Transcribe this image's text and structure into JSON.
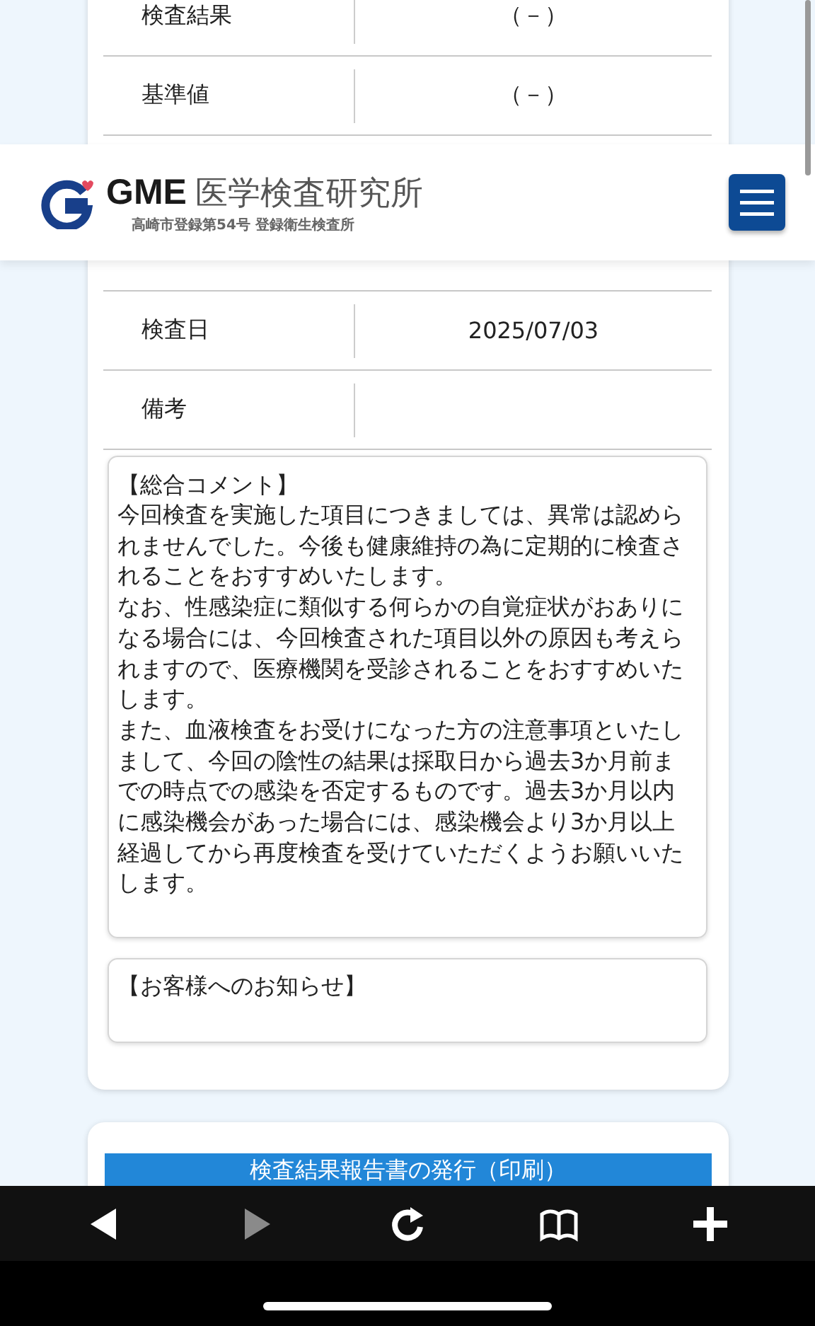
{
  "header": {
    "brand": "GME",
    "name": "医学検査研究所",
    "subtitle": "高崎市登録第54号 登録衛生検査所"
  },
  "results": [
    {
      "label": "検査結果",
      "value": "（－）"
    },
    {
      "label": "基準値",
      "value": "（－）"
    },
    {
      "label": "検査日",
      "value": "2025/07/03",
      "hidden_before": true
    },
    {
      "label": "備考"
    }
  ],
  "comment": {
    "heading": "【総合コメント】",
    "paragraphs": [
      "今回検査を実施した項目につきましては、異常は認められませんでした。今後も健康維持の為に定期的に検査されることをおすすめいたします。",
      "なお、性感染症に類似する何らかの自覚症状がおありになる場合には、今回検査された項目以外の原因も考えられますので、医療機関を受診されることをおすすめいたします。",
      "また、血液検査をお受けになった方の注意事項といたしまして、今回の陰性の結果は採取日から過去3か月前までの時点での感染を否定するものです。過去3か月以内に感染機会があった場合には、感染機会より3か月以上経過してから再度検査を受けていただくようお願いいたします。"
    ]
  },
  "notice": {
    "heading": "【お客様へのお知らせ】"
  },
  "print_button": "検査結果報告書の発行（印刷）",
  "toolbar": [
    {
      "kind": "back",
      "disabled": false
    },
    {
      "kind": "forward",
      "disabled": true
    },
    {
      "kind": "reload",
      "disabled": false
    },
    {
      "kind": "bookmarks",
      "disabled": false
    },
    {
      "kind": "add",
      "disabled": false
    }
  ]
}
